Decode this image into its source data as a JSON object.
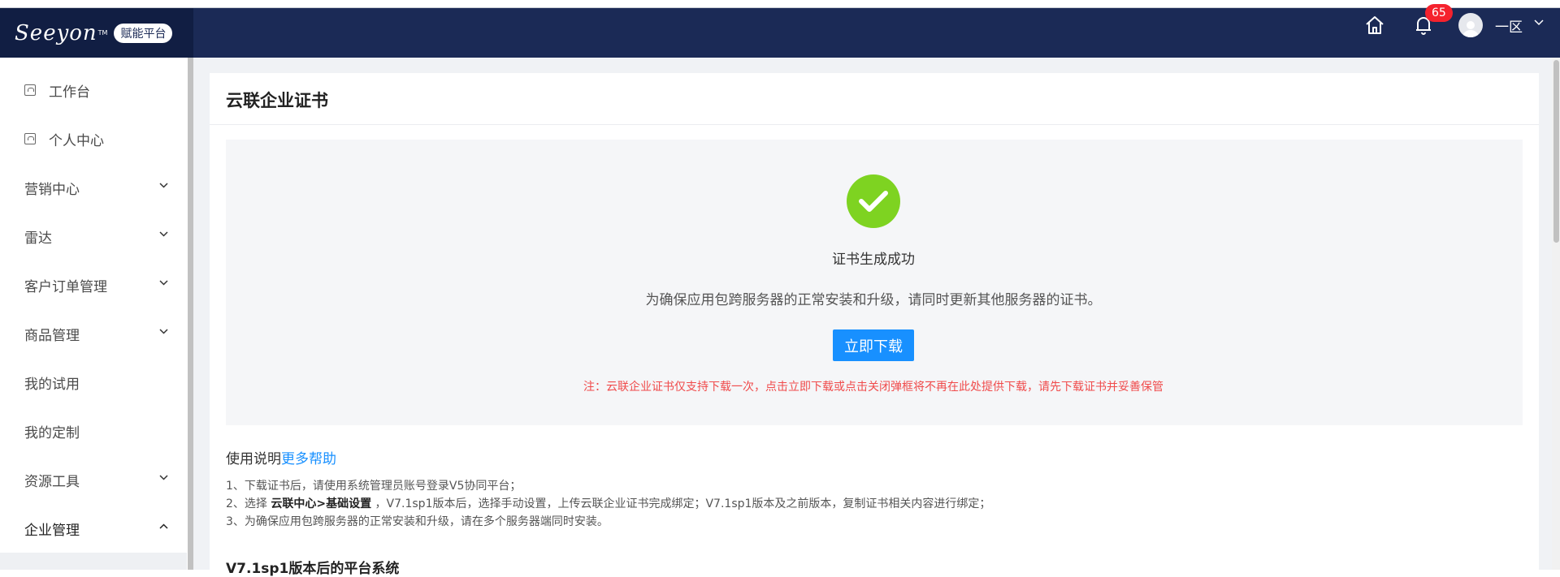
{
  "header": {
    "logo": "Seeyon",
    "logo_tm": "TM",
    "platform_badge": "赋能平台",
    "notification_count": "65",
    "user_name": "一区",
    "brand_color": "#1b2a56"
  },
  "sidebar": {
    "items": [
      {
        "label": "工作台",
        "icon": "page-icon"
      },
      {
        "label": "个人中心",
        "icon": "page-icon"
      },
      {
        "label": "营销中心",
        "expandable": true
      },
      {
        "label": "雷达",
        "expandable": true
      },
      {
        "label": "客户订单管理",
        "expandable": true
      },
      {
        "label": "商品管理",
        "expandable": true
      },
      {
        "label": "我的试用"
      },
      {
        "label": "我的定制"
      },
      {
        "label": "资源工具",
        "expandable": true
      },
      {
        "label": "企业管理",
        "expanded": true
      }
    ]
  },
  "main": {
    "title": "云联企业证书",
    "result": {
      "title": "证书生成成功",
      "description": "为确保应用包跨服务器的正常安装和升级，请同时更新其他服务器的证书。",
      "download_label": "立即下载",
      "note": "注：云联企业证书仅支持下载一次，点击立即下载或点击关闭弹框将不再在此处提供下载，请先下载证书并妥善保管",
      "success_color": "#7ed321",
      "note_color": "#f04b4b"
    },
    "usage": {
      "title": "使用说明",
      "help_link": "更多帮助",
      "line1": "1、下载证书后，请使用系统管理员账号登录V5协同平台；",
      "line2_prefix": "2、选择 ",
      "line2_bold": "云联中心>基础设置",
      "line2_suffix": " ，V7.1sp1版本后，选择手动设置，上传云联企业证书完成绑定；V7.1sp1版本及之前版本，复制证书相关内容进行绑定；",
      "line3": "3、为确保应用包跨服务器的正常安装和升级，请在多个服务器端同时安装。"
    },
    "section_title": "V7.1sp1版本后的平台系统"
  }
}
